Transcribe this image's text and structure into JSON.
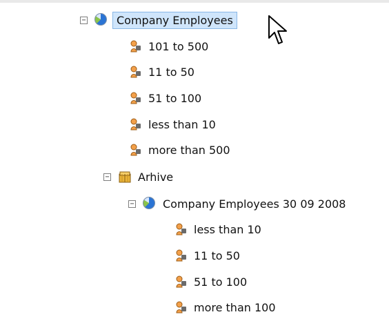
{
  "tree": {
    "root": {
      "label": "Company Employees",
      "children": [
        "101 to 500",
        "11 to 50",
        "51 to 100",
        "less than 10",
        "more than 500"
      ]
    },
    "archive": {
      "label": "Arhive",
      "snapshot": {
        "label": "Company Employees 30 09 2008",
        "children": [
          "less than 10",
          "11 to 50",
          "51 to 100",
          "more than 100"
        ]
      }
    }
  },
  "icons": {
    "pie": "pie-chart-icon",
    "person": "person-icon",
    "archive": "archive-icon",
    "expander": "minus-icon",
    "cursor": "mouse-cursor-icon"
  },
  "colors": {
    "selection_fill": "#cfe5fb",
    "selection_border": "#88b7e6",
    "pie_blue": "#2b74d4",
    "pie_green": "#8bc34a",
    "person_orange": "#f3a04a",
    "archive_yellow": "#e9b43a"
  }
}
